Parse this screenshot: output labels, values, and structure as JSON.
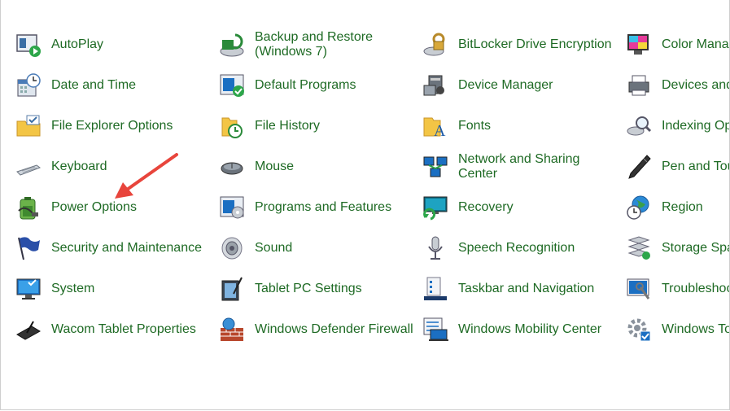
{
  "control_panel": {
    "columns": [
      {
        "items": [
          {
            "label": "AutoPlay",
            "icon": "autoplay-icon"
          },
          {
            "label": "Date and Time",
            "icon": "date-time-icon"
          },
          {
            "label": "File Explorer Options",
            "icon": "folder-options-icon"
          },
          {
            "label": "Keyboard",
            "icon": "keyboard-icon"
          },
          {
            "label": "Power Options",
            "icon": "power-options-icon"
          },
          {
            "label": "Security and Maintenance",
            "icon": "flag-icon"
          },
          {
            "label": "System",
            "icon": "system-icon"
          },
          {
            "label": "Wacom Tablet Properties",
            "icon": "wacom-tablet-icon"
          }
        ]
      },
      {
        "items": [
          {
            "label": "Backup and Restore (Windows 7)",
            "icon": "backup-icon"
          },
          {
            "label": "Default Programs",
            "icon": "default-programs-icon"
          },
          {
            "label": "File History",
            "icon": "file-history-icon"
          },
          {
            "label": "Mouse",
            "icon": "mouse-icon"
          },
          {
            "label": "Programs and Features",
            "icon": "programs-features-icon"
          },
          {
            "label": "Sound",
            "icon": "speaker-icon"
          },
          {
            "label": "Tablet PC Settings",
            "icon": "tablet-pc-icon"
          },
          {
            "label": "Windows Defender Firewall",
            "icon": "firewall-icon"
          }
        ]
      },
      {
        "items": [
          {
            "label": "BitLocker Drive Encryption",
            "icon": "bitlocker-icon"
          },
          {
            "label": "Device Manager",
            "icon": "device-manager-icon"
          },
          {
            "label": "Fonts",
            "icon": "fonts-icon"
          },
          {
            "label": "Network and Sharing Center",
            "icon": "network-icon"
          },
          {
            "label": "Recovery",
            "icon": "recovery-icon"
          },
          {
            "label": "Speech Recognition",
            "icon": "microphone-icon"
          },
          {
            "label": "Taskbar and Navigation",
            "icon": "taskbar-icon"
          },
          {
            "label": "Windows Mobility Center",
            "icon": "mobility-center-icon"
          }
        ]
      },
      {
        "items": [
          {
            "label": "Color Manag",
            "icon": "color-management-icon"
          },
          {
            "label": "Devices and",
            "icon": "devices-printers-icon"
          },
          {
            "label": "Indexing Opt",
            "icon": "indexing-icon"
          },
          {
            "label": "Pen and Tou",
            "icon": "pen-icon"
          },
          {
            "label": "Region",
            "icon": "region-icon"
          },
          {
            "label": "Storage Spa",
            "icon": "storage-spaces-icon"
          },
          {
            "label": "Troubleshoo",
            "icon": "troubleshooting-icon"
          },
          {
            "label": "Windows To",
            "icon": "windows-tools-icon"
          }
        ]
      }
    ]
  },
  "colors": {
    "link": "#1e6a24",
    "annotation_arrow": "#e8453c"
  }
}
